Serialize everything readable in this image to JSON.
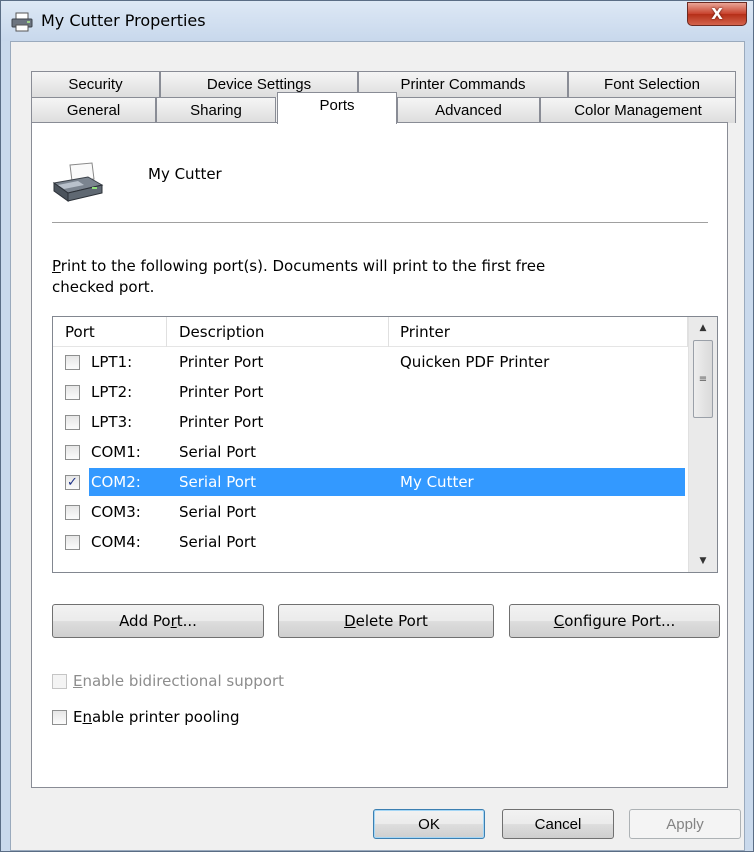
{
  "window": {
    "title": "My Cutter Properties",
    "close_label": "X"
  },
  "tabs_row1": [
    "Security",
    "Device Settings",
    "Printer Commands",
    "Font Selection"
  ],
  "tabs_row2": [
    "General",
    "Sharing",
    "Ports",
    "Advanced",
    "Color Management"
  ],
  "selected_tab": "Ports",
  "printer": {
    "name": "My Cutter"
  },
  "description": {
    "line1_mnemonic": "P",
    "line1_rest": "rint to the following port(s). Documents will print to the first free",
    "line2": "checked port."
  },
  "ports_table": {
    "headers": {
      "port": "Port",
      "description": "Description",
      "printer": "Printer"
    },
    "rows": [
      {
        "port": "LPT1:",
        "description": "Printer Port",
        "printer": "Quicken PDF Printer",
        "checked": false,
        "selected": false
      },
      {
        "port": "LPT2:",
        "description": "Printer Port",
        "printer": "",
        "checked": false,
        "selected": false
      },
      {
        "port": "LPT3:",
        "description": "Printer Port",
        "printer": "",
        "checked": false,
        "selected": false
      },
      {
        "port": "COM1:",
        "description": "Serial Port",
        "printer": "",
        "checked": false,
        "selected": false
      },
      {
        "port": "COM2:",
        "description": "Serial Port",
        "printer": "My Cutter",
        "checked": true,
        "selected": true
      },
      {
        "port": "COM3:",
        "description": "Serial Port",
        "printer": "",
        "checked": false,
        "selected": false
      },
      {
        "port": "COM4:",
        "description": "Serial Port",
        "printer": "",
        "checked": false,
        "selected": false
      }
    ],
    "check_mark": "✓",
    "scroll_up": "▲",
    "scroll_down": "▼",
    "thumb_grip": "≡"
  },
  "port_buttons": {
    "add": {
      "before": "Add Po",
      "mnemonic": "r",
      "after": "t..."
    },
    "delete": {
      "before": "",
      "mnemonic": "D",
      "after": "elete Port"
    },
    "configure": {
      "before": "",
      "mnemonic": "C",
      "after": "onfigure Port..."
    }
  },
  "options": {
    "bidirectional": {
      "mnemonic": "E",
      "rest": "nable bidirectional support",
      "checked": false,
      "enabled": false
    },
    "pooling": {
      "before": "E",
      "mnemonic": "n",
      "after": "able printer pooling",
      "checked": false,
      "enabled": true
    }
  },
  "dialog_buttons": {
    "ok": "OK",
    "cancel": "Cancel",
    "apply": "Apply"
  },
  "colors": {
    "selection": "#3399ff",
    "title_bar": "#c9d9ec",
    "close_button": "#c7412c"
  },
  "icons": {
    "title": "printer-icon",
    "printer": "printer-icon"
  }
}
